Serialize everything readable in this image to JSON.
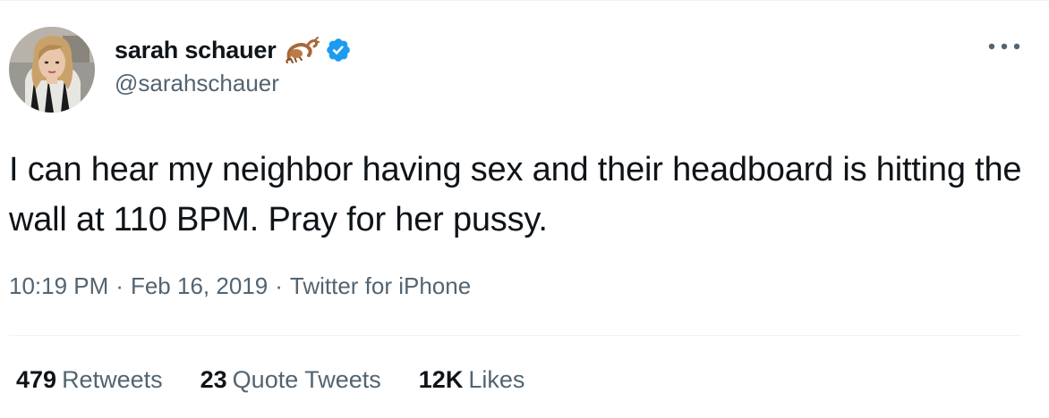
{
  "author": {
    "display_name": "sarah schauer",
    "handle": "@sarahschauer",
    "verified": true
  },
  "tweet": {
    "text": "I can hear my neighbor having sex and their headboard is hitting the wall at 110 BPM. Pray for her pussy.",
    "time": "10:19 PM",
    "date": "Feb 16, 2019",
    "source": "Twitter for iPhone"
  },
  "stats": {
    "retweets_count": "479",
    "retweets_label": "Retweets",
    "quote_count": "23",
    "quote_label": "Quote Tweets",
    "likes_count": "12K",
    "likes_label": "Likes"
  },
  "icons": {
    "name_emoji": "scorpion-icon",
    "verified": "verified-badge-icon",
    "more": "more-options-icon"
  },
  "colors": {
    "text_primary": "#0f1419",
    "text_secondary": "#536471",
    "verified_blue": "#1d9bf0",
    "divider": "#eff3f4"
  }
}
